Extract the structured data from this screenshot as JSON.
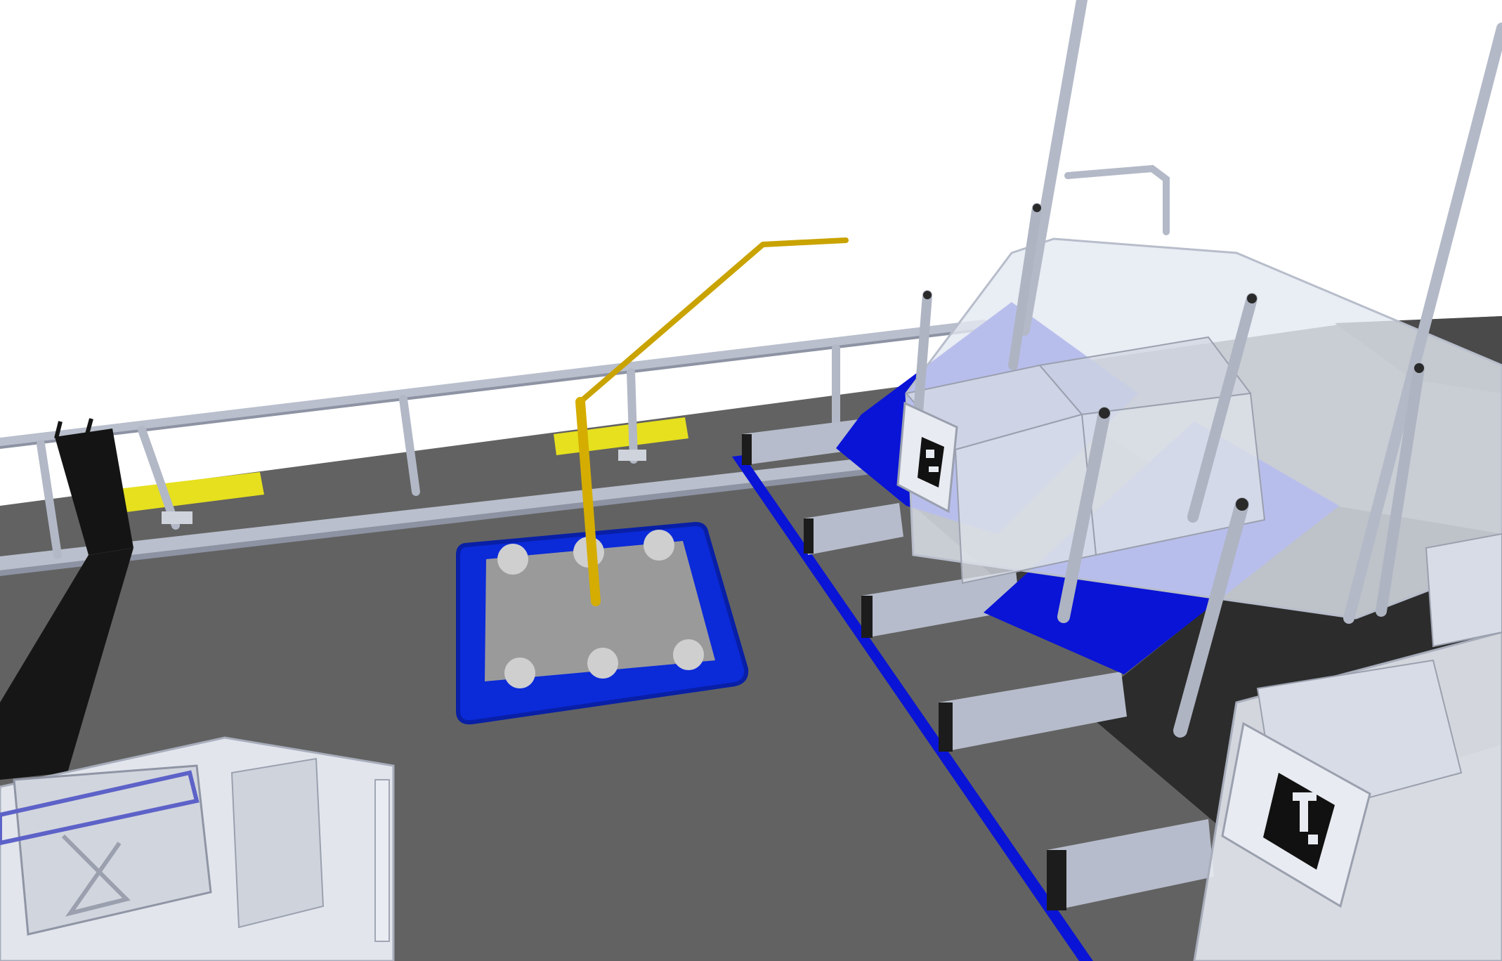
{
  "viewport": {
    "kind": "3d-simulation-view",
    "background_color": "#ffffff"
  },
  "colors": {
    "floor": "#616161",
    "floor_dark": "#2e2e2e",
    "rail": "#b9bfcc",
    "rail_shadow": "#8d93a3",
    "blue_accent": "#0a14d6",
    "blue_float": "#0b2ad8",
    "yellow_marker": "#e6e01e",
    "mustard_rod": "#c9a300",
    "glass": "#e4e8f1",
    "black_plank": "#141414"
  },
  "objects": [
    {
      "name": "arena-floor"
    },
    {
      "name": "perimeter-railing"
    },
    {
      "name": "blue-float-tray"
    },
    {
      "name": "yellow-rod"
    },
    {
      "name": "blue-divider-line"
    },
    {
      "name": "station-bays"
    },
    {
      "name": "glass-enclosures"
    },
    {
      "name": "black-post"
    },
    {
      "name": "yellow-floor-markers"
    }
  ]
}
